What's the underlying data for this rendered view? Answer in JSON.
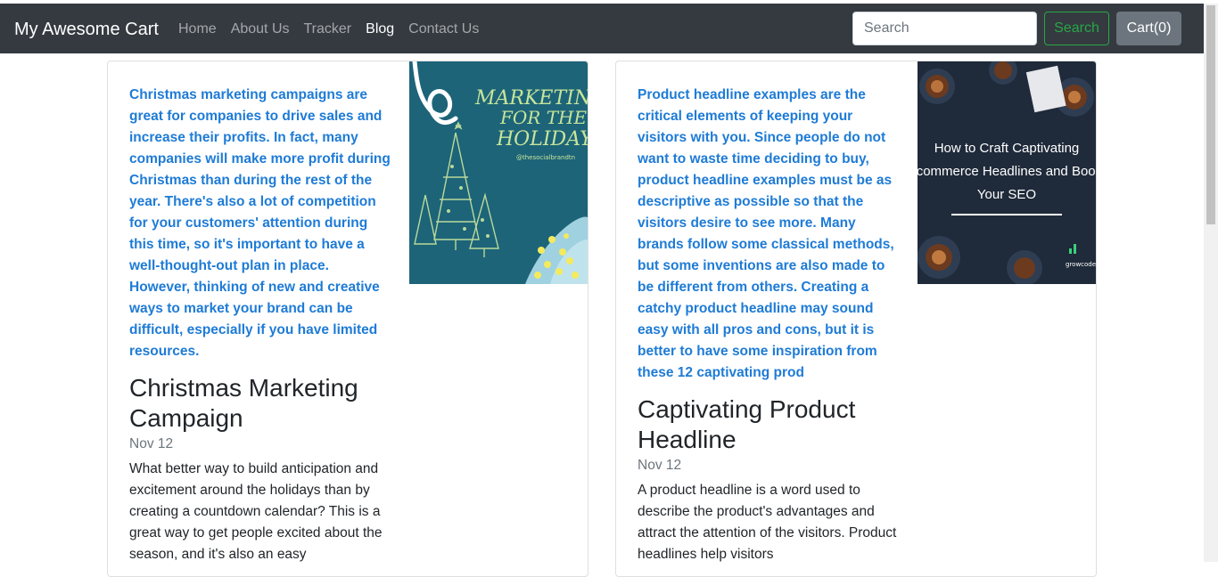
{
  "navbar": {
    "brand": "My Awesome Cart",
    "links": [
      "Home",
      "About Us",
      "Tracker",
      "Blog",
      "Contact Us"
    ],
    "active_link": "Blog",
    "search_placeholder": "Search",
    "search_button": "Search",
    "cart_button": "Cart(0)"
  },
  "posts": [
    {
      "excerpt": "Christmas marketing campaigns are great for companies to drive sales and increase their profits. In fact, many companies will make more profit during Christmas than during the rest of the year. There's also a lot of competition for your customers' attention during this time, so it's important to have a well-thought-out plan in place. However, thinking of new and creative ways to market your brand can be difficult, especially if you have limited resources.",
      "title": "Christmas Marketing Campaign",
      "date": "Nov 12",
      "description": "What better way to build anticipation and excitement around the holidays than by creating a countdown calendar? This is a great way to get people excited about the season, and it's also an easy",
      "image": {
        "line1": "MARKETING",
        "line2": "FOR THE",
        "line3": "HOLIDAYS",
        "handle": "@thesocialbrandtn"
      }
    },
    {
      "excerpt": "Product headline examples are the critical elements of keeping your visitors with you. Since people do not want to waste time deciding to buy, product headline examples must be as descriptive as possible so that the visitors desire to see more. Many brands follow some classical methods, but some inventions are also made to be different from others. Creating a catchy product headline may sound easy with all pros and cons, but it is better to have some inspiration from these 12 captivating prod",
      "title": "Captivating Product Headline",
      "date": "Nov 12",
      "description": "A product headline is a word used to describe the product's advantages and attract the attention of the visitors. Product headlines help visitors",
      "image": {
        "line1": "How to Craft Captivating",
        "line2": "Ecommerce Headlines and Boost",
        "line3": "Your SEO",
        "logo": "growcode"
      }
    }
  ],
  "colors": {
    "navbar_bg": "#343a40",
    "excerpt": "#1e7bd6",
    "search_green": "#28a745",
    "cart_gray": "#6c757d"
  }
}
